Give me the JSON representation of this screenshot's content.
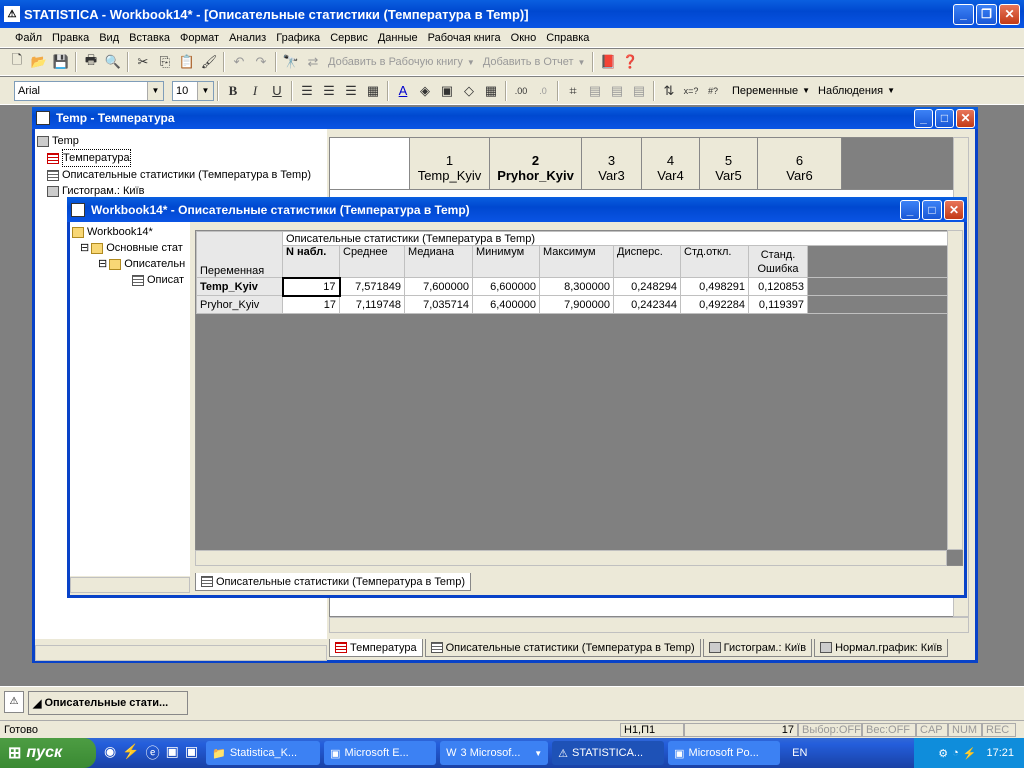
{
  "app": {
    "title": "STATISTICA - Workbook14* - [Описательные статистики (Температура в Temp)]"
  },
  "menu": [
    "Файл",
    "Правка",
    "Вид",
    "Вставка",
    "Формат",
    "Анализ",
    "Графика",
    "Сервис",
    "Данные",
    "Рабочая книга",
    "Окно",
    "Справка"
  ],
  "toolbar1": {
    "add_workbook": "Добавить в Рабочую книгу",
    "add_report": "Добавить в Отчет"
  },
  "toolbar2": {
    "font": "Arial",
    "size": "10",
    "variables": "Переменные",
    "cases": "Наблюдения"
  },
  "temp_window": {
    "title": "Temp - Температура",
    "tree": [
      "Temp",
      "Температура",
      "Описательные статистики (Температура в Temp)",
      "Гистограм.: Київ"
    ],
    "columns": [
      {
        "num": "1",
        "name": "Temp_Kyiv"
      },
      {
        "num": "2",
        "name": "Pryhor_Kyiv"
      },
      {
        "num": "3",
        "name": "Var3"
      },
      {
        "num": "4",
        "name": "Var4"
      },
      {
        "num": "5",
        "name": "Var5"
      },
      {
        "num": "6",
        "name": "Var6"
      }
    ],
    "tabs": [
      "Температура",
      "Описательные статистики (Температура в Temp)",
      "Гистограм.: Київ",
      "Нормал.график: Київ"
    ]
  },
  "workbook_window": {
    "title": "Workbook14* - Описательные статистики (Температура в Temp)",
    "tree": [
      "Workbook14*",
      "Основные стат",
      "Описательн",
      "Описат"
    ],
    "table_title": "Описательные статистики (Температура в Temp)",
    "row_header": "Переменная",
    "columns": [
      "N набл.",
      "Среднее",
      "Медиана",
      "Минимум",
      "Максимум",
      "Дисперс.",
      "Стд.откл.",
      "Станд.",
      "Ошибка"
    ],
    "rows": [
      {
        "name": "Temp_Kyiv",
        "values": [
          "17",
          "7,571849",
          "7,600000",
          "6,600000",
          "8,300000",
          "0,248294",
          "0,498291",
          "0,120853"
        ]
      },
      {
        "name": "Pryhor_Kyiv",
        "values": [
          "17",
          "7,119748",
          "7,035714",
          "6,400000",
          "7,900000",
          "0,242344",
          "0,492284",
          "0,119397"
        ]
      }
    ],
    "tab": "Описательные статистики (Температура в Temp)"
  },
  "minimized": {
    "label": "Описательные стати..."
  },
  "status": {
    "ready": "Готово",
    "cell": "H1,П1",
    "count": "17",
    "sel": "Выбор:OFF",
    "weight": "Вес:OFF",
    "caps": "CAP",
    "num": "NUM",
    "rec": "REC"
  },
  "taskbar": {
    "start": "пуск",
    "items": [
      "Statistica_K...",
      "Microsoft E...",
      "3 Microsof...",
      "STATISTICA...",
      "Microsoft Po..."
    ],
    "lang": "EN",
    "time": "17:21"
  }
}
